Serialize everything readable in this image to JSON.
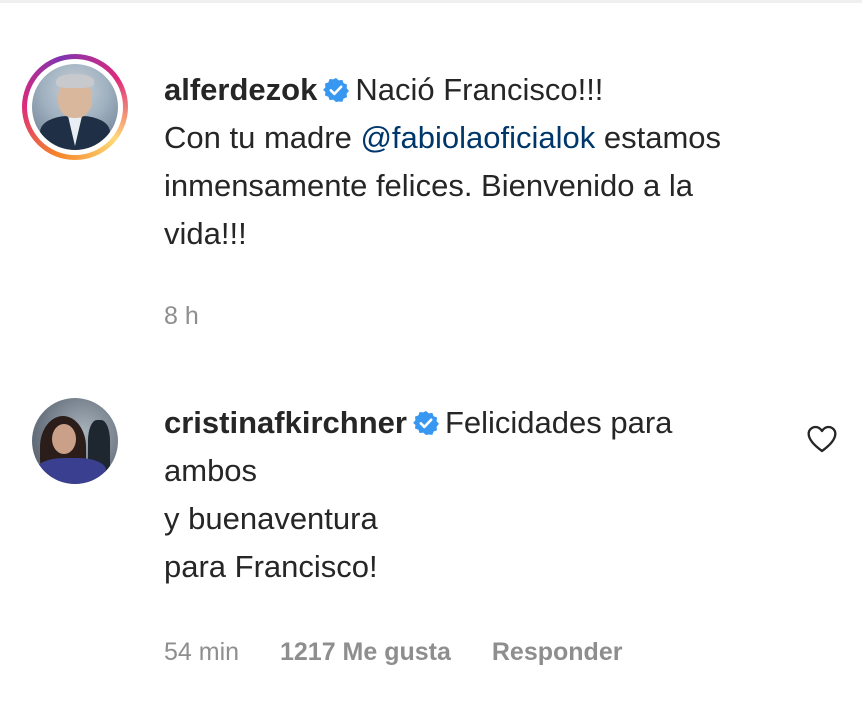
{
  "comments": [
    {
      "username": "alferdezok",
      "verified": true,
      "text_first": "Nació Francisco!!!",
      "line2_prefix": "Con tu madre ",
      "mention": "@fabiolaoficialok",
      "line2_suffix": " estamos",
      "line3": "inmensamente felices. Bienvenido a la",
      "line4": "vida!!!",
      "time": "8 h",
      "avatar_icon": "profile-photo"
    },
    {
      "username": "cristinafkirchner",
      "verified": true,
      "text_first": "Felicidades para",
      "line2": "ambos",
      "line3": "y buenaventura",
      "line4": "para Francisco!",
      "time": "54 min",
      "likes": "1217 Me gusta",
      "reply": "Responder",
      "avatar_icon": "profile-photo",
      "like_icon": "heart-outline-icon"
    }
  ],
  "colors": {
    "text": "#262626",
    "secondary": "#8e8e8e",
    "mention": "#00376b",
    "verified": "#3897f0"
  }
}
